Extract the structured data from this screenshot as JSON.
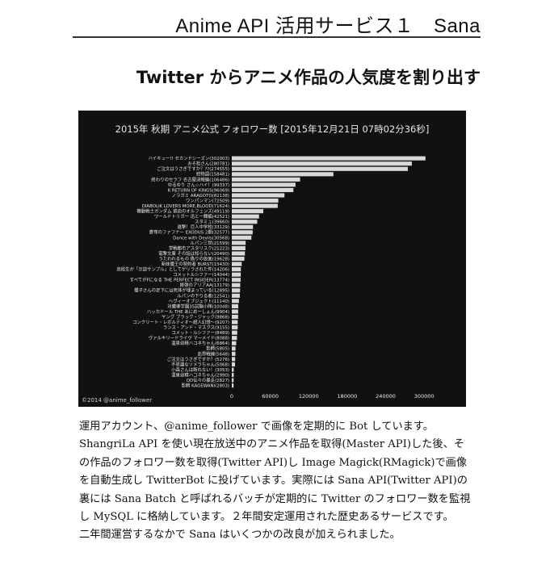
{
  "header": {
    "title": "Anime API 活用サービス１　Sana"
  },
  "subtitle": "Twitter からアニメ作品の人気度を割り出す",
  "chart_data": {
    "type": "bar",
    "orientation": "horizontal",
    "title": "2015年 秋期 アニメ公式 フォロワー数 [2015年12月21日 07時02分36秒]",
    "credit": "©2014 @anime_follower",
    "xlim": [
      0,
      330000
    ],
    "xticks": [
      0,
      60000,
      120000,
      180000,
      240000,
      300000
    ],
    "categories": [
      "ハイキュー!! セカンドシーズン(302003)",
      "おそ松さん(280781)",
      "ご注文はうさぎですか？??(274555)",
      "終物語(158481)",
      "終わりのセラフ 名古屋決戦編(106486)",
      "ゆるゆり さん☆ハイ！(99337)",
      "K RETURN OF KINGS(96069)",
      "ノラガミ ARAGOTO(82138)",
      "ワンパンマン(72509)",
      "DIABOLIK LOVERS MORE,BLOOD(71624)",
      "機動戦士ガンダム 鉄血のオルフェンズ(49119)",
      "ワールドトリガー 迅と一輝編(42521)",
      "スタミュ(39660)",
      "進撃！巨人中学校(33129)",
      "蒼穹のファフナー EXODUS 2期(32577)",
      "Dance with Devils(30568)",
      "ルパン三世(21599)",
      "学戦都市アスタリスク(21223)",
      "電撃文庫 その話は知らない(20490)",
      "うたわれるもの 偽りの仮面(19628)",
      "新妹魔王の契約者 BURST(15430)",
      "高校生が「示談サンプル」としてゲリラされた件(14206)",
      "コメットルシファー(14044)",
      "すべてがFになる THE PERFECT INSIDER(13774)",
      "緋弾のアリアAA(13179)",
      "櫻子さんの足下には死体が埋まっている(12895)",
      "ルパンの下りる者(12541)",
      "ヘヴィーオブジェクト(11140)",
      "対魔導学園35試験小隊(10048)",
      "ハッカドール THE あにめーしょん(9904)",
      "ヤング ブラック・ジャック(9868)",
      "コンクリート・レボルティオ〜超人幻想〜(9207)",
      "ランス・アンド・マスクス(9155)",
      "コメット・ルシファー(8489)",
      "ヴァルキリードライヴ マーメイド(8088)",
      "温泉幼精ハコネちゃん(6864)",
      "影鰐(5805)",
      "血界戦線(5648)",
      "ご注文はうさぎですか？(5276)",
      "不思議なソメラちゃん(5068)",
      "小森さんは断れない！(3053)",
      "温泉幼精ハコネちゃん(2990)",
      "OD伝々の暴走(2827)",
      "影鰐 KAGEWANI(2803)"
    ],
    "values": [
      302003,
      280781,
      274555,
      158481,
      106486,
      99337,
      96069,
      82138,
      72509,
      71624,
      49119,
      42521,
      39660,
      33129,
      32577,
      30568,
      21599,
      21223,
      20490,
      19628,
      15430,
      14206,
      14044,
      13774,
      13179,
      12895,
      12541,
      11140,
      10048,
      9904,
      9868,
      9207,
      9155,
      8489,
      8088,
      6864,
      5805,
      5648,
      5276,
      5068,
      3053,
      2990,
      2827,
      2803
    ],
    "colors": {
      "background": "#111111",
      "bar": "#d9d9d9",
      "text": "#e8e8e8"
    },
    "grid": false
  },
  "body": {
    "lines": [
      "運用アカウント、@anime_follower で画像を定期的に Bot しています。",
      "ShangriLa API を使い現在放送中のアニメ作品を取得(Master API)した後、そ",
      "の作品のフォロワー数を取得(Twitter API)し Image Magick(RMagick)で画像",
      "を自動生成し TwitterBot に投げています。実際には Sana API(Twitter API)の",
      "裏には Sana Batch と呼ばれるバッチが定期的に Twitter のフォロワー数を監視",
      "し MySQL に格納しています。２年間安定運用された歴史あるサービスです。",
      "二年間運営するなかで Sana はいくつかの改良が加えられました。"
    ]
  }
}
